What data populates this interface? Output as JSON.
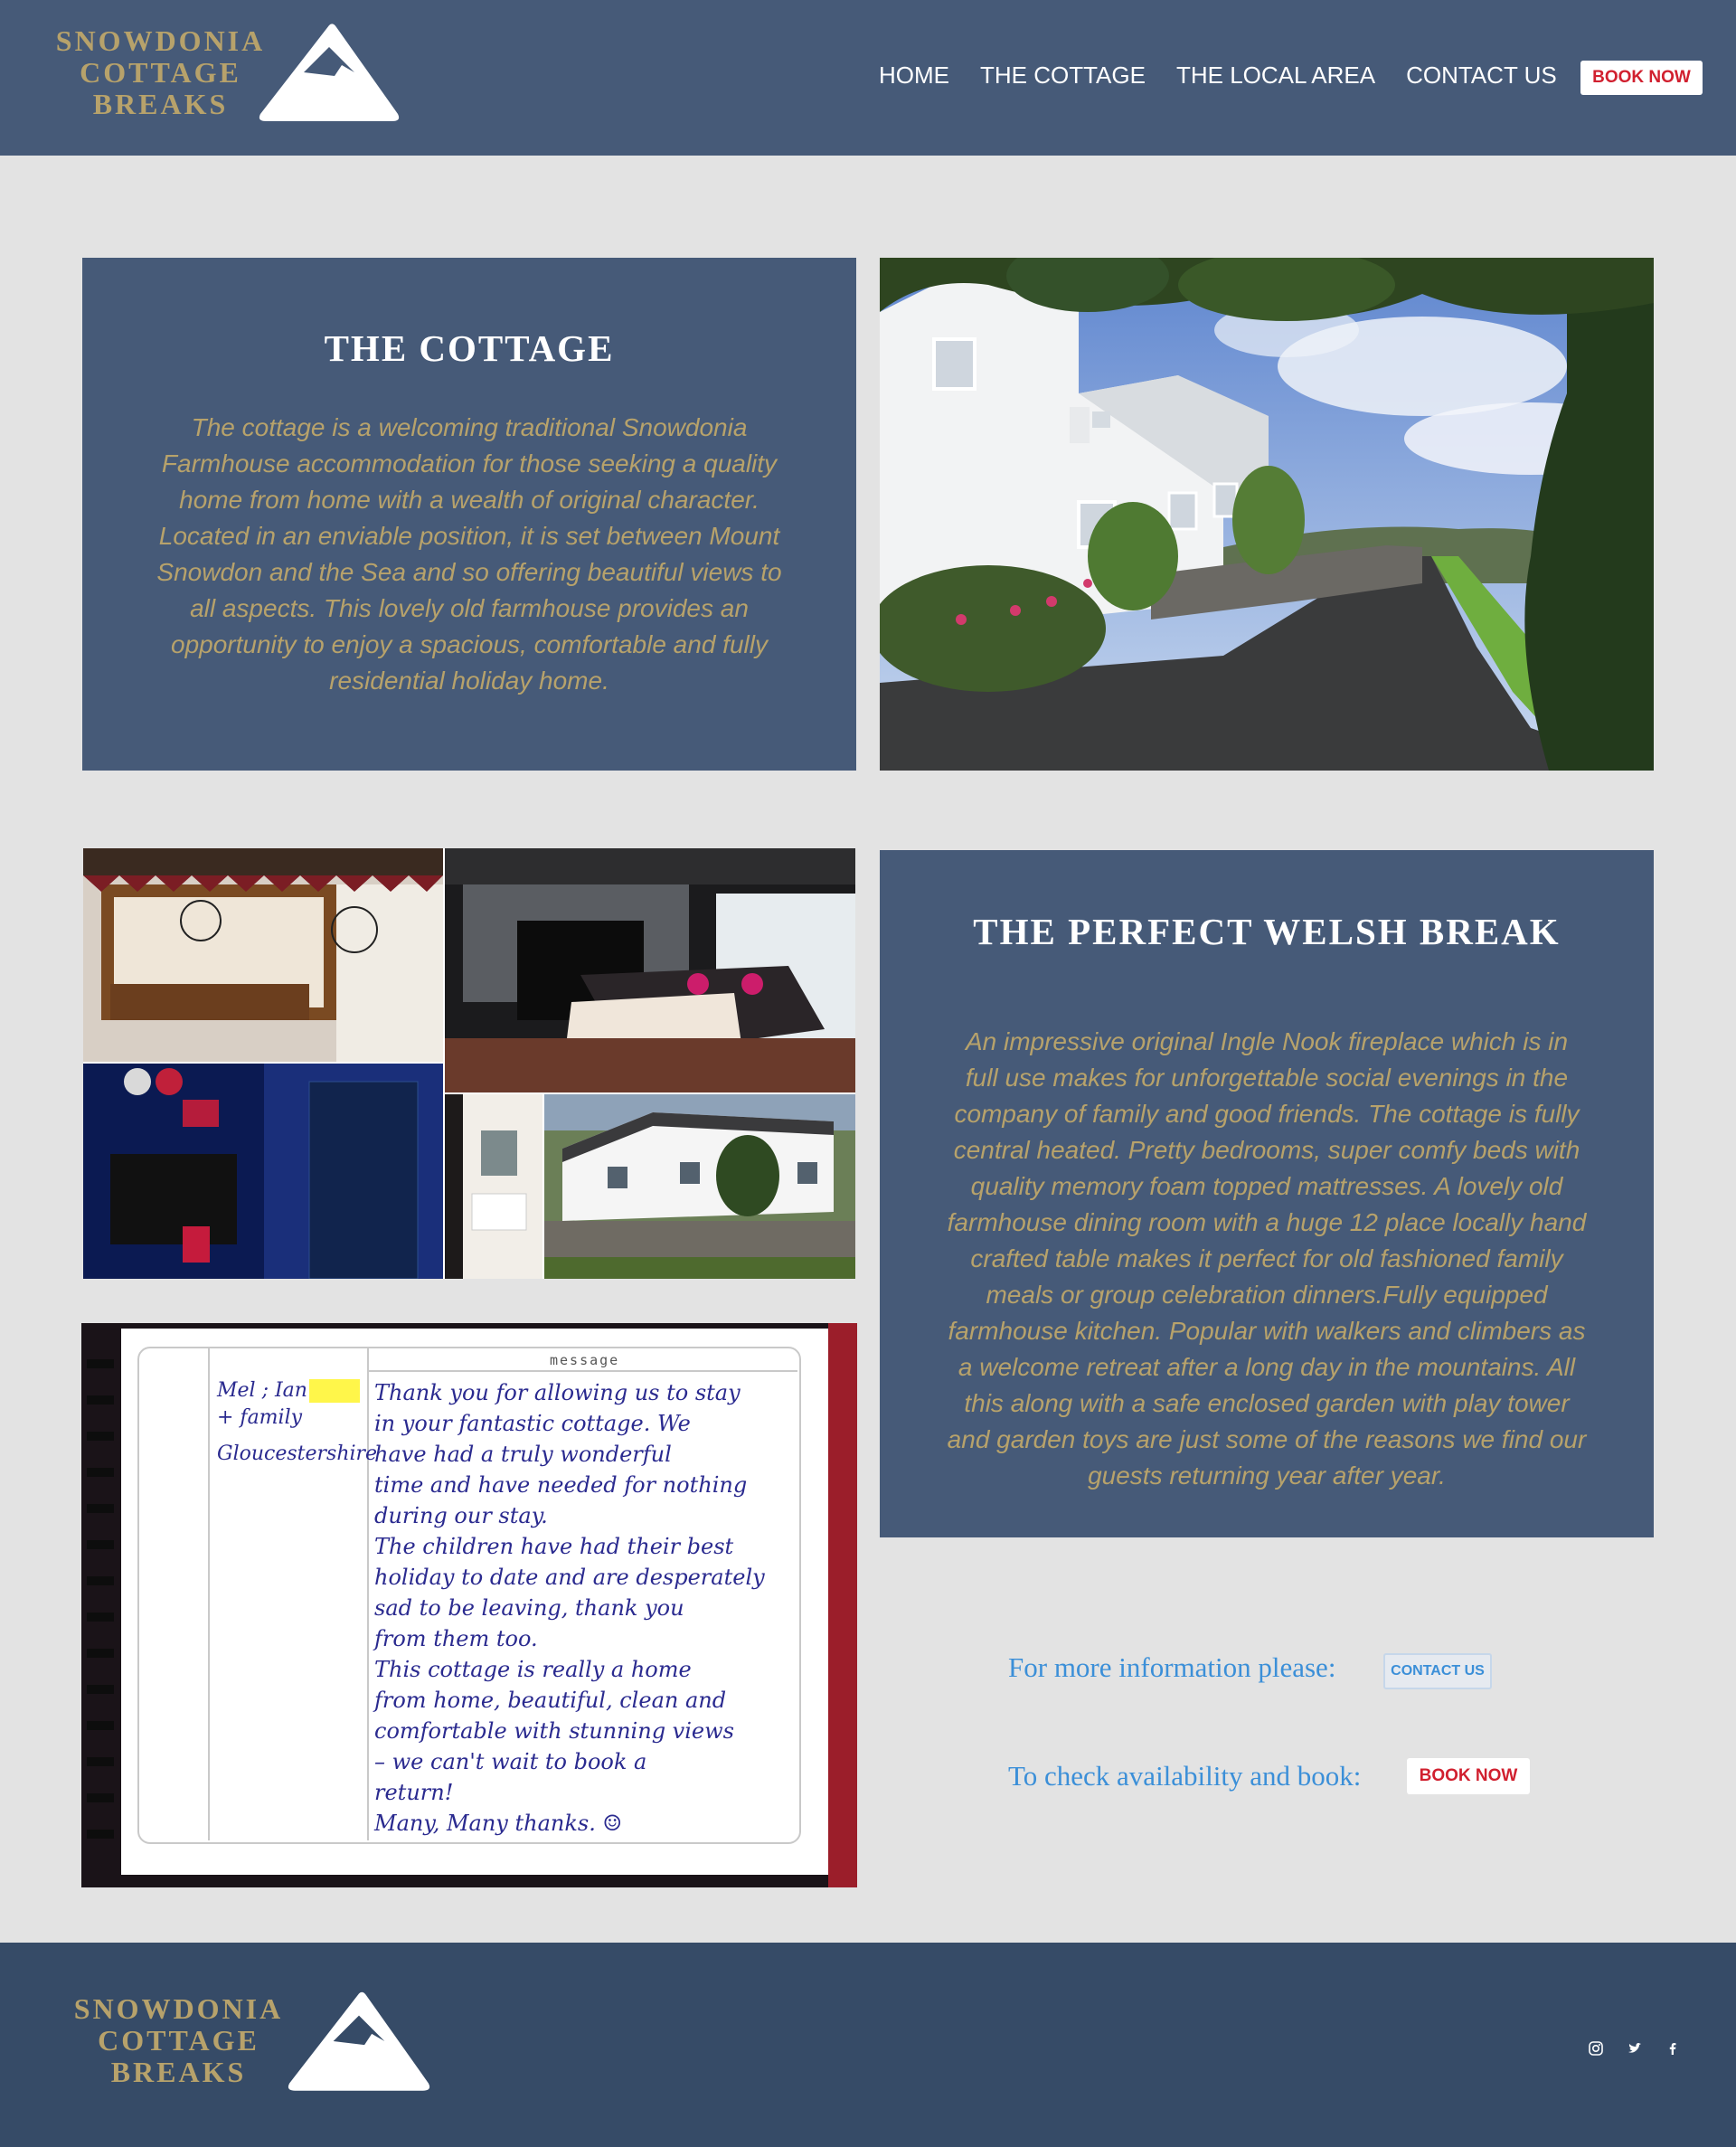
{
  "brand": {
    "line1": "SNOWDONIA",
    "line2": "COTTAGE",
    "line3": "BREAKS"
  },
  "nav": {
    "items": [
      "HOME",
      "THE COTTAGE",
      "THE LOCAL AREA",
      "CONTACT US"
    ],
    "book_label": "BOOK NOW"
  },
  "cottage": {
    "title": "THE COTTAGE",
    "lines": [
      "The cottage is a welcoming traditional Snowdonia",
      "Farmhouse accommodation for those seeking a quality",
      "home from home with a wealth of original character.",
      "Located in an enviable position, it is set between Mount",
      "Snowdon and the Sea and so offering beautiful views to",
      "all aspects. This lovely old farmhouse provides an",
      "opportunity to enjoy a spacious, comfortable and fully",
      "residential holiday home."
    ]
  },
  "welsh_break": {
    "title": "THE PERFECT WELSH BREAK",
    "lines": [
      "An impressive original Ingle Nook fireplace which is in",
      "full use makes for unforgettable social evenings in the",
      "company of family and good friends. The cottage is fully",
      "central heated. Pretty bedrooms, super comfy beds with",
      "quality memory foam topped mattresses. A lovely old",
      "farmhouse dining room with a huge 12 place locally hand",
      "crafted table makes it perfect for old fashioned family",
      "meals or group celebration dinners.Fully equipped",
      "farmhouse kitchen. Popular with walkers and climbers as",
      "a welcome retreat after a long day in the mountains.  All",
      "this along with a safe enclosed garden with play tower",
      "and garden toys are just some of the reasons we find our",
      "guests returning year after year."
    ]
  },
  "cta": {
    "info_text": "For more information please:",
    "contact_label": "CONTACT US",
    "book_text": "To check availability and book:",
    "book_label": "BOOK NOW"
  },
  "guestbook": {
    "header": "message",
    "name_lines": [
      "Mel ; Ian",
      "+ family",
      "Gloucestershire"
    ],
    "message_lines": [
      "Thank you for allowing us to stay",
      "in your fantastic cottage. We",
      "have had a truly wonderful",
      "time and have needed for nothing",
      "during our stay.",
      "The children have had their best",
      "holiday to date and are desperately",
      "sad to be leaving, thank you",
      "from them too.",
      "This cottage is really a home",
      "from home, beautiful, clean and",
      "comfortable with stunning views",
      "– we can't wait to book a",
      "return!",
      "Many, Many thanks. ☺"
    ]
  },
  "social": [
    "instagram-icon",
    "twitter-icon",
    "facebook-icon"
  ],
  "colors": {
    "header": "#465a78",
    "footer": "#364b67",
    "gold": "#b7a26b",
    "link": "#3b8fd8",
    "book": "#d1202f",
    "page": "#e3e3e3"
  }
}
